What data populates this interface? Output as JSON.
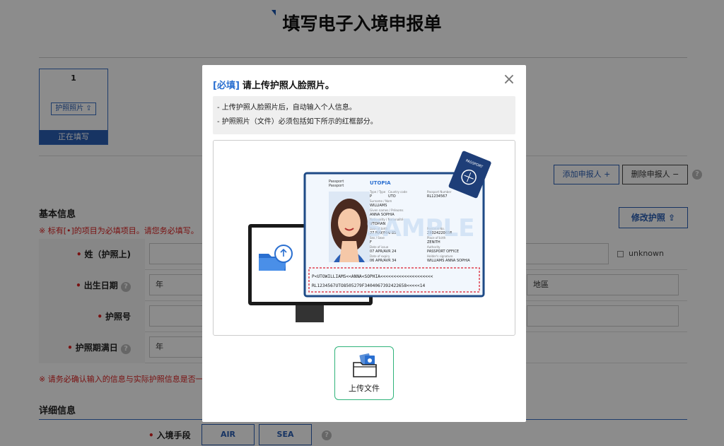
{
  "page": {
    "title": "填写电子入境申报单"
  },
  "tab": {
    "number": "1",
    "passport_button": "护照照片 ⇪",
    "status": "正在填写"
  },
  "actions": {
    "add_applicant": "添加申报人 +",
    "delete_applicant": "删除申报人 −",
    "help": "?"
  },
  "basic_info": {
    "title": "基本信息",
    "required_note": "※ 标有[•]的项目为必填项目。请您务必填写。",
    "edit_passport": "修改护照 ⇪",
    "rows": [
      {
        "label": "姓（护照上)",
        "value": ""
      },
      {
        "label": "出生日期",
        "value": "年"
      },
      {
        "label": "护照号",
        "value": ""
      },
      {
        "label": "护照期满日",
        "value": "年"
      }
    ],
    "unknown": "unknown",
    "select_partial": "地區"
  },
  "confirm_note": "※ 请务必确认输入的信息与实际护照信息是否一致",
  "detail_info": {
    "title": "详细信息",
    "entry_means_label": "入境手段",
    "air": "AIR",
    "sea": "SEA"
  },
  "modal": {
    "required_tag": "[必填]",
    "title": "请上传护照人脸照片。",
    "info_lines": [
      "- 上传护照人脸照片后，自动输入个人信息。",
      "- 护照照片（文件）必须包括如下所示的红框部分。"
    ],
    "close": "×",
    "upload_label": "上传文件",
    "passport": {
      "country": "UTOPIA",
      "passport_word": "Passport",
      "type": "P",
      "code": "UTO",
      "number": "RL1234567",
      "surname": "WILLIAMS",
      "given_names": "ANNA SOPHIA",
      "nationality": "UTOPIAN",
      "dob": "27 MAY/MAI 85",
      "personal_no": "Z8024220658",
      "sex": "F",
      "place_of_birth": "ZENITH",
      "date_of_issue": "07 APR/AVR 24",
      "authority": "PASSPORT OFFICE",
      "date_of_expiry": "06 APR/AVR 34",
      "holder_signature": "WILLIAMS ANNA SOPHIA",
      "watermark": "SAMPLE",
      "mrz_line1": "P<UTOWILLIAMS<<ANNA<SOPHIA<<<<<<<<<<<<<<<<<<<<",
      "mrz_line2": "RL1234567UTO8505279F3404067392422658<<<<<14",
      "cover_label": "PASSPORT"
    }
  },
  "colors": {
    "brand_blue": "#2a5fb5",
    "required_red": "#dd2222",
    "upload_green": "#2fb37a",
    "mrz_red": "#e04050"
  }
}
